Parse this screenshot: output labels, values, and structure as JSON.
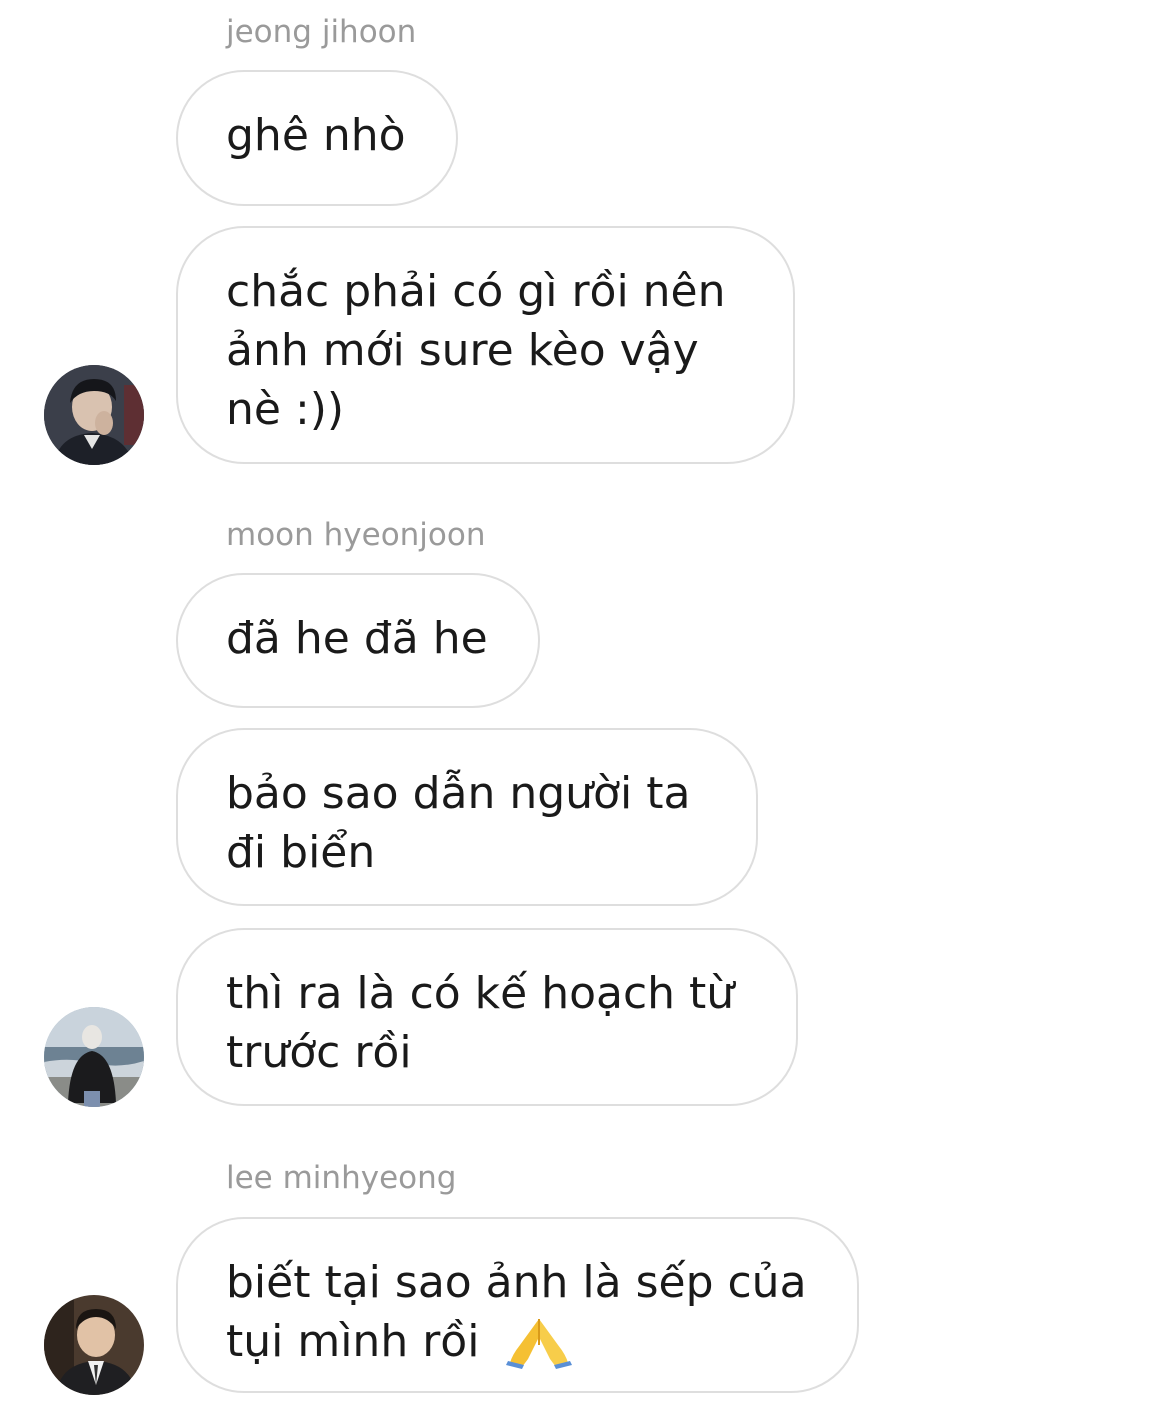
{
  "groups": [
    {
      "sender": "jeong jihoon",
      "avatar_icon": "user-avatar-dark-portrait",
      "messages": [
        "ghê nhò",
        "chắc phải có gì rồi nên\nảnh mới sure kèo vậy\nnè :))"
      ]
    },
    {
      "sender": "moon hyeonjoon",
      "avatar_icon": "user-avatar-beach-photo",
      "messages": [
        "đã he đã he",
        "bảo sao dẫn người ta\nđi biển",
        "thì ra là có kế hoạch từ\ntrước rồi"
      ]
    },
    {
      "sender": "lee minhyeong",
      "avatar_icon": "user-avatar-suit-portrait",
      "messages": [
        "biết tại sao ảnh là sếp của\ntụi mình rồi"
      ],
      "emoji": "folded-hands-icon"
    }
  ]
}
